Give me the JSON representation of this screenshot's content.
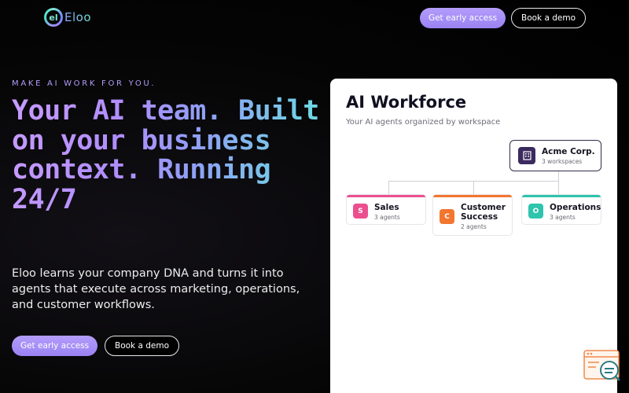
{
  "header": {
    "logo_glyph": "el",
    "logo_text": "Eloo",
    "cta_primary": "Get early access",
    "cta_secondary": "Book a demo"
  },
  "hero": {
    "eyebrow": "MAKE AI WORK FOR YOU.",
    "headline": "Your AI team. Built on your business context. Running 24/7",
    "subtitle": "Eloo learns your company DNA and turns it into agents that execute across marketing, operations, and customer workflows.",
    "cta_primary": "Get early access",
    "cta_secondary": "Book a demo"
  },
  "workforce_card": {
    "title": "AI Workforce",
    "subtitle": "Your AI agents organized by workspace",
    "org": {
      "name": "Acme Corp.",
      "meta": "3 workspaces",
      "icon": "building-icon"
    },
    "workspaces": [
      {
        "letter": "S",
        "name": "Sales",
        "meta": "3 agents",
        "color": "#ec4f8f"
      },
      {
        "letter": "C",
        "name": "Customer Success",
        "meta": "2 agents",
        "color": "#f3762f"
      },
      {
        "letter": "O",
        "name": "Operations",
        "meta": "3 agents",
        "color": "#2ec4ad"
      }
    ]
  },
  "colors": {
    "accent_purple": "#a78bfa",
    "accent_teal": "#6ee7d8",
    "background": "#000000"
  }
}
